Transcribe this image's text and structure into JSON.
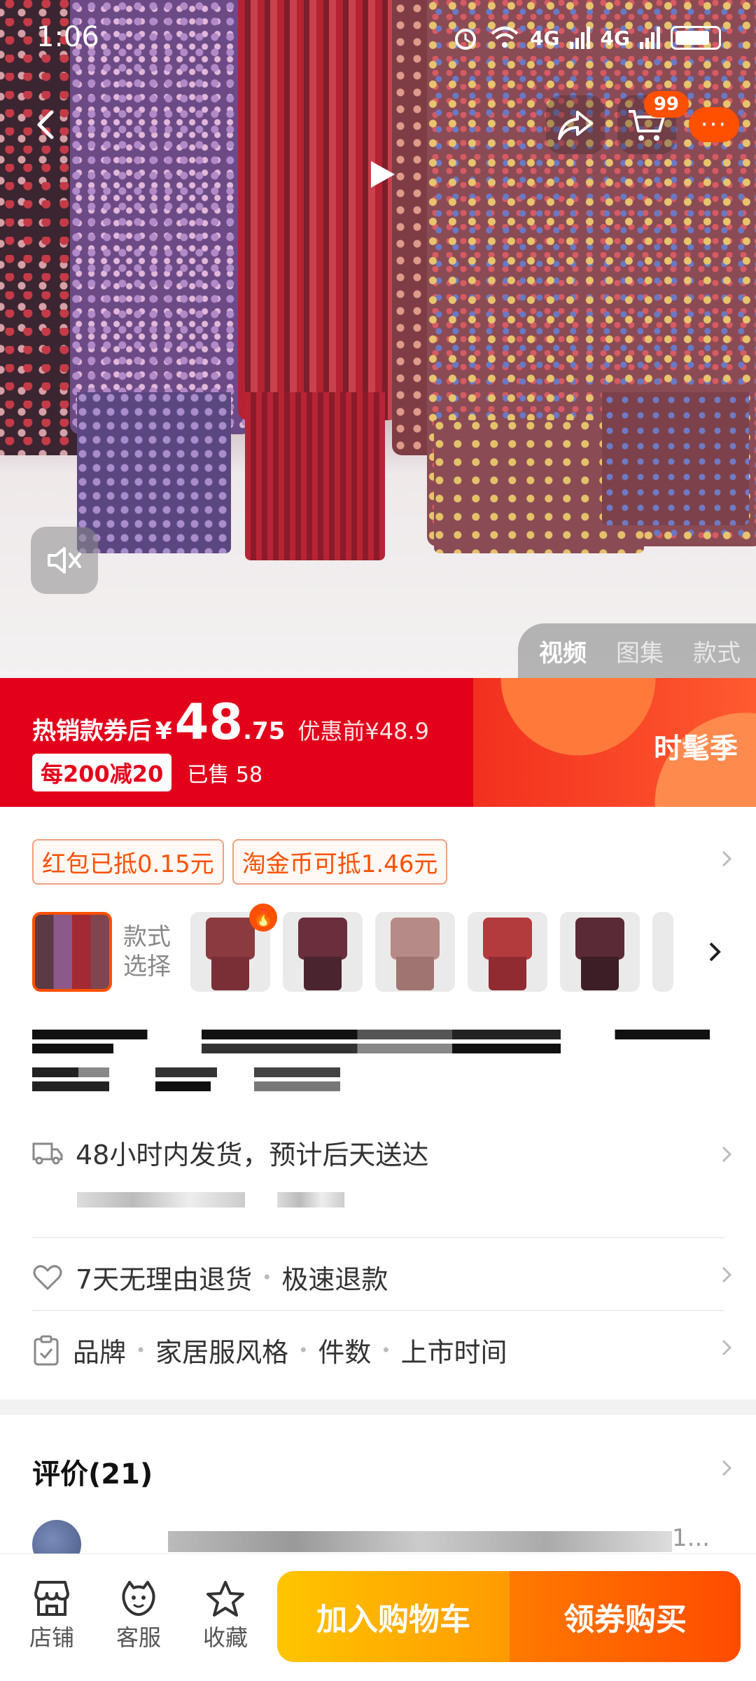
{
  "status_bar": {
    "time": "1:06",
    "network1": "4G",
    "network2": "4G"
  },
  "header": {
    "cart_badge": "99",
    "more_label": "···"
  },
  "media_tabs": [
    "视频",
    "图集",
    "款式"
  ],
  "price": {
    "prefix": "热销款券后",
    "currency": "¥",
    "integer": "48",
    "decimal": ".75",
    "original": "优惠前¥48.9",
    "promo": "每200减20",
    "sold": "已售 58",
    "season": "时髦季"
  },
  "coupons": [
    "红包已抵0.15元",
    "淘金币可抵1.46元"
  ],
  "variants": {
    "label_line1": "款式",
    "label_line2": "选择",
    "thumbs": [
      {
        "shirt": "#8b3a40",
        "pant": "#7a2e36"
      },
      {
        "shirt": "#6a2e3c",
        "pant": "#4a2530"
      },
      {
        "shirt": "#b68a86",
        "pant": "#a07470"
      },
      {
        "shirt": "#b33a3d",
        "pant": "#8f2b31"
      },
      {
        "shirt": "#5a2a36",
        "pant": "#3d1e27"
      }
    ]
  },
  "shipping": {
    "text": "48小时内发货，预计后天送达"
  },
  "returns": {
    "text1": "7天无理由退货",
    "text2": "极速退款"
  },
  "params": {
    "items": [
      "品牌",
      "家居服风格",
      "件数",
      "上市时间"
    ]
  },
  "reviews": {
    "title": "评价(21)",
    "more": "1..."
  },
  "bottom_bar": {
    "shop_label": "店铺",
    "service_label": "客服",
    "favorite_label": "收藏",
    "cart_button": "加入购物车",
    "buy_button": "领券购买"
  }
}
